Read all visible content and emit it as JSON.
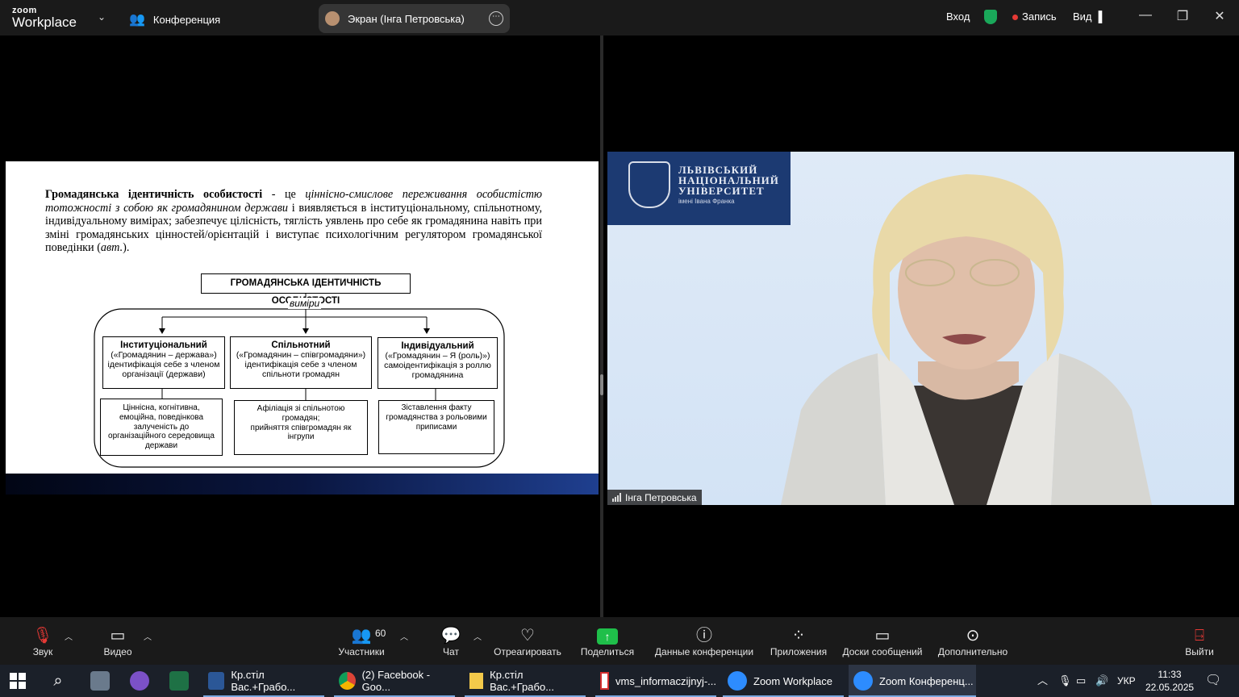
{
  "titlebar": {
    "logo_top": "zoom",
    "logo_bottom": "Workplace",
    "conference_label": "Конференция",
    "screen_pill": "Экран (Інга Петровська)",
    "login_label": "Вход",
    "record_label": "Запись",
    "view_label": "Вид",
    "colors": {
      "shield": "#1aa85a",
      "record": "#e53935"
    }
  },
  "slide": {
    "definition_term": "Громадянська ідентичність особистості",
    "definition_dash": " - це ",
    "definition_italic1": "ціннісно-смислове переживання особистістю тотожності з собою як громадянином держави",
    "definition_rest": " і виявляється в інституціональному, спільнотному, індивідуальному вимірах; забезпечує цілісність, тяглість уявлень про себе як громадянина навіть при зміні громадянських цінностей/орієнтацій і виступає психологічним регулятором громадянської поведінки (",
    "definition_author": "авт.",
    "definition_end": ").",
    "diagram_title": "ГРОМАДЯНСЬКА ІДЕНТИЧНІСТЬ ОСОБИСТОСТІ",
    "dimensions_label": "виміри",
    "columns": [
      {
        "title": "Інституціональний",
        "line1": "(«Громадянин – держава»)",
        "line2": "ідентифікація себе з членом",
        "line3": "організації (держави)",
        "sub1": "Ціннісна, когнітивна,",
        "sub2": "емоційна, поведінкова",
        "sub3": "залученість до",
        "sub4": "організаційного середовища",
        "sub5": "держави"
      },
      {
        "title": "Спільнотний",
        "line1": "(«Громадянин – співгромадяни»)",
        "line2": "ідентифікація себе з членом",
        "line3": "спільноти громадян",
        "sub1": "Афіліація зі спільнотою",
        "sub2": "громадян;",
        "sub3": "прийняття співгромадян як",
        "sub4": "інгрупи",
        "sub5": ""
      },
      {
        "title": "Індивідуальний",
        "line1": "(«Громадянин – Я (роль)»)",
        "line2": "самоідентифікація з роллю",
        "line3": "громадянина",
        "sub1": "Зіставлення факту",
        "sub2": "громадянства з рольовими",
        "sub3": "приписами",
        "sub4": "",
        "sub5": ""
      }
    ]
  },
  "video": {
    "uni_line1": "ЛЬВІВСЬКИЙ",
    "uni_line2": "НАЦІОНАЛЬНИЙ",
    "uni_line3": "УНІВЕРСИТЕТ",
    "uni_sub": "імені Івана Франка",
    "participant_name": "Інга Петровська"
  },
  "toolbar": {
    "audio": "Звук",
    "video": "Видео",
    "participants": "Участники",
    "participants_count": "60",
    "chat": "Чат",
    "react": "Отреагировать",
    "share": "Поделиться",
    "meeting_info": "Данные конференции",
    "apps": "Приложения",
    "whiteboards": "Доски сообщений",
    "more": "Дополнительно",
    "leave": "Выйти"
  },
  "taskbar": {
    "items": [
      "Кр.стіл Вас.+Грабо...",
      "(2) Facebook - Goo...",
      "Кр.стіл Вас.+Грабо...",
      "vms_informaczijnyj-...",
      "Zoom Workplace",
      "Zoom Конференц..."
    ],
    "lang": "УКР",
    "time": "11:33",
    "date": "22.05.2025"
  }
}
